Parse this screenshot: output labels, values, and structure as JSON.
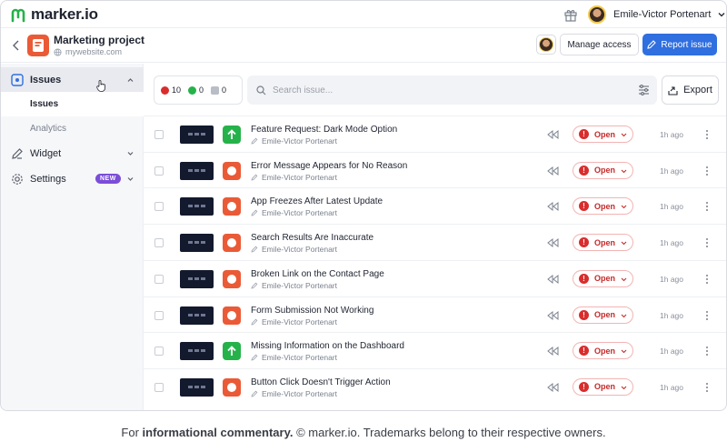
{
  "app": {
    "logo_text": "marker.io"
  },
  "topbar": {
    "user_name": "Emile-Victor Portenart"
  },
  "project": {
    "title": "Marketing project",
    "url": "mywebsite.com"
  },
  "actions": {
    "manage_access": "Manage access",
    "report_issue": "Report issue"
  },
  "sidebar": {
    "issues_label": "Issues",
    "sub_items": [
      {
        "label": "Issues"
      },
      {
        "label": "Analytics"
      }
    ],
    "widget_label": "Widget",
    "settings_label": "Settings",
    "settings_badge": "NEW"
  },
  "counts": {
    "red": "10",
    "green": "0",
    "grey": "0"
  },
  "search": {
    "placeholder": "Search issue..."
  },
  "export_label": "Export",
  "issues": [
    {
      "title": "Feature Request: Dark Mode Option",
      "author": "Emile-Victor Portenart",
      "priority": "green-arrow",
      "status": "Open",
      "time": "1h ago"
    },
    {
      "title": "Error Message Appears for No Reason",
      "author": "Emile-Victor Portenart",
      "priority": "orange-circle",
      "status": "Open",
      "time": "1h ago"
    },
    {
      "title": "App Freezes After Latest Update",
      "author": "Emile-Victor Portenart",
      "priority": "orange-circle",
      "status": "Open",
      "time": "1h ago"
    },
    {
      "title": "Search Results Are Inaccurate",
      "author": "Emile-Victor Portenart",
      "priority": "orange-circle",
      "status": "Open",
      "time": "1h ago"
    },
    {
      "title": "Broken Link on the Contact Page",
      "author": "Emile-Victor Portenart",
      "priority": "orange-circle",
      "status": "Open",
      "time": "1h ago"
    },
    {
      "title": "Form Submission Not Working",
      "author": "Emile-Victor Portenart",
      "priority": "orange-circle",
      "status": "Open",
      "time": "1h ago"
    },
    {
      "title": "Missing Information on the Dashboard",
      "author": "Emile-Victor Portenart",
      "priority": "green-arrow",
      "status": "Open",
      "time": "1h ago"
    },
    {
      "title": "Button Click Doesn't Trigger Action",
      "author": "Emile-Victor Portenart",
      "priority": "orange-circle",
      "status": "Open",
      "time": "1h ago"
    }
  ],
  "footer": {
    "pre": "For ",
    "bold": "informational commentary.",
    "post": " © marker.io. Trademarks belong to their respective owners."
  },
  "colors": {
    "accent": "#2f6fe0",
    "brand": "#ea5a36",
    "open_red": "#d92d2d",
    "green": "#25b24a",
    "badge_purple": "#7b4ed8"
  }
}
